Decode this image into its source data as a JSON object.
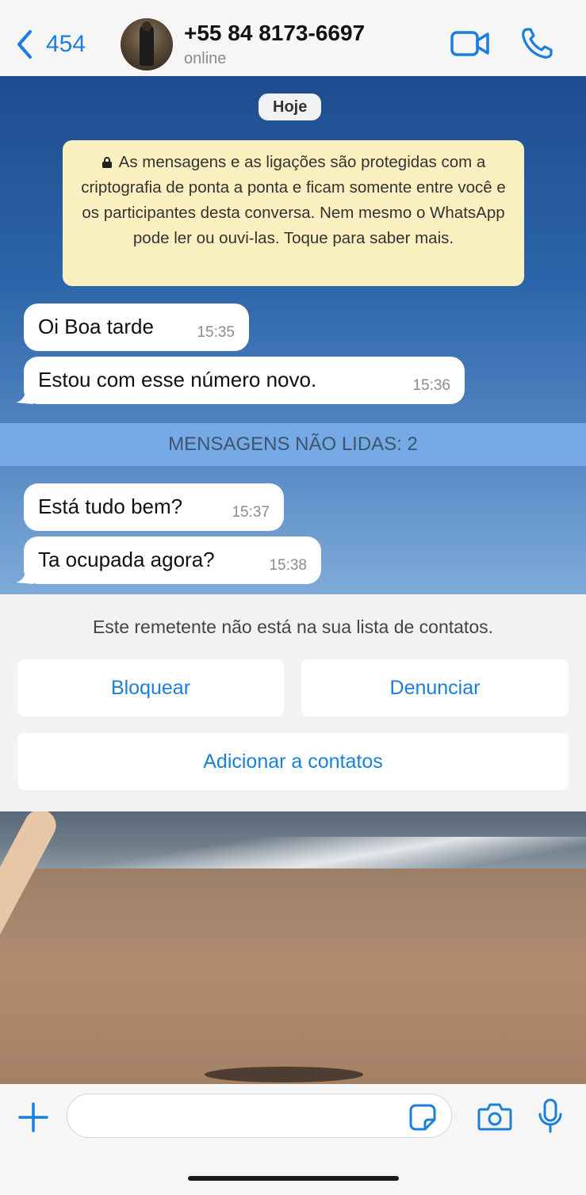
{
  "header": {
    "back_count": "454",
    "contact_name": "+55 84 8173-6697",
    "status": "online"
  },
  "chat": {
    "date_label": "Hoje",
    "encryption_notice": "As mensagens e as ligações são protegidas com a criptografia de ponta a ponta e ficam somente entre você e os participantes desta conversa. Nem mesmo o WhatsApp pode ler ou ouvi-las. Toque para saber mais.",
    "messages": [
      {
        "text": "Oi Boa tarde",
        "time": "15:35"
      },
      {
        "text": "Estou com esse número novo.",
        "time": "15:36"
      },
      {
        "text": "Está tudo bem?",
        "time": "15:37"
      },
      {
        "text": "Ta ocupada agora?",
        "time": "15:38"
      }
    ],
    "unread_label": "MENSAGENS NÃO LIDAS: 2"
  },
  "unknown_sender": {
    "notice": "Este remetente não está na sua lista de contatos.",
    "block_label": "Bloquear",
    "report_label": "Denunciar",
    "add_contact_label": "Adicionar a contatos"
  },
  "input": {
    "placeholder": ""
  },
  "icons": {
    "back": "chevron-left-icon",
    "video": "video-camera-icon",
    "call": "phone-icon",
    "lock": "lock-icon",
    "plus": "plus-icon",
    "sticker": "sticker-icon",
    "camera": "camera-icon",
    "mic": "microphone-icon"
  },
  "colors": {
    "accent": "#1a7fdc",
    "notice_bg": "#fbf0c0",
    "unread_bar": "#7aace8"
  }
}
